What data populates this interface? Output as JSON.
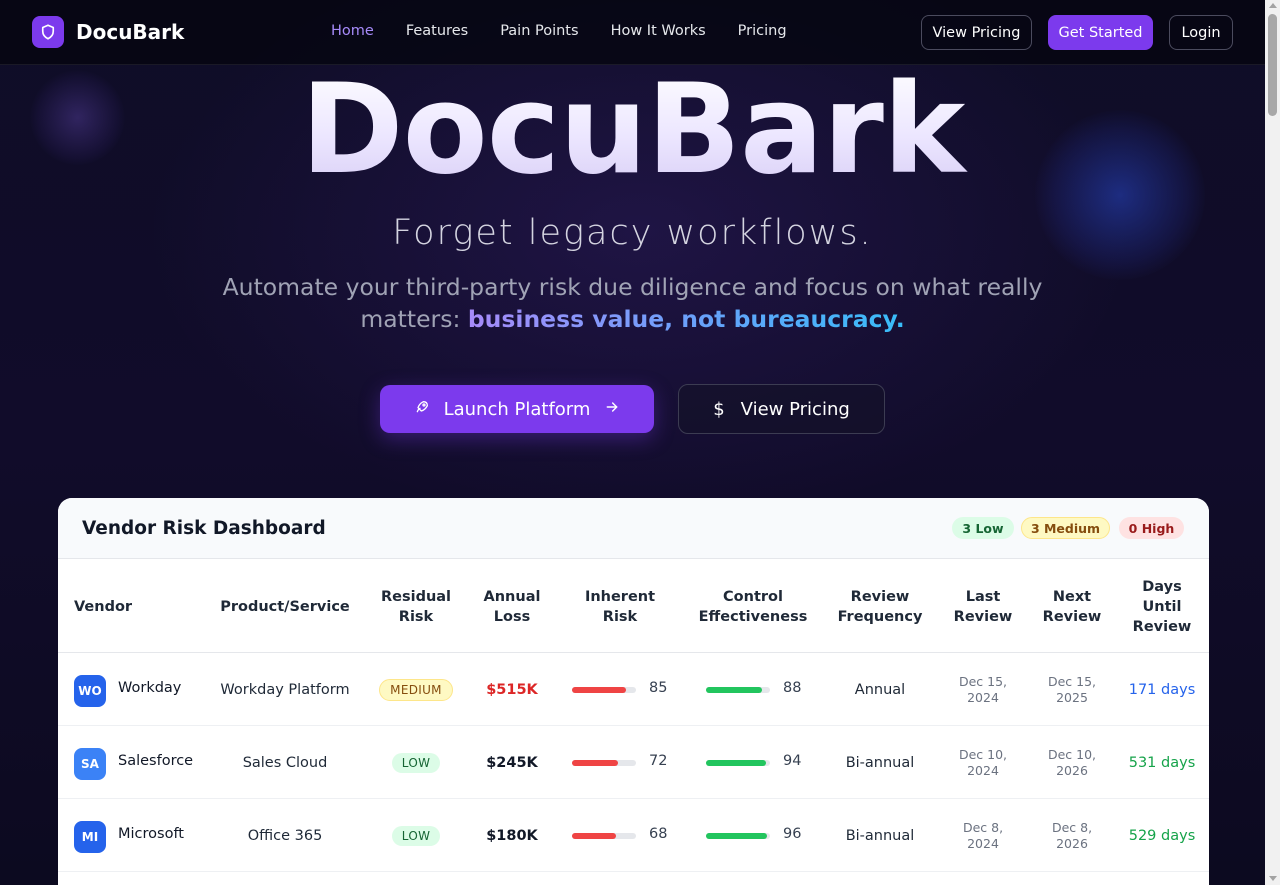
{
  "nav": {
    "brand": "DocuBark",
    "links": [
      "Home",
      "Features",
      "Pain Points",
      "How It Works",
      "Pricing"
    ],
    "view_pricing": "View Pricing",
    "get_started": "Get Started",
    "login": "Login"
  },
  "hero": {
    "title": "DocuBark",
    "subtitle": "Forget legacy workflows.",
    "desc_prefix": "Automate your third-party risk due diligence and focus on what really matters:",
    "desc_highlight": "business value, not bureaucracy.",
    "launch_label": "Launch Platform",
    "pricing_label": "View Pricing",
    "pricing_symbol": "$"
  },
  "dashboard": {
    "title": "Vendor Risk Dashboard",
    "counts": {
      "low": "3 Low",
      "medium": "3 Medium",
      "high": "0 High"
    },
    "columns": [
      "Vendor",
      "Product/Service",
      "Residual Risk",
      "Annual Loss",
      "Inherent Risk",
      "Control Effectiveness",
      "Review Frequency",
      "Last Review",
      "Next Review",
      "Days Until Review"
    ],
    "rows": [
      {
        "initials": "WO",
        "vendor": "Workday",
        "product": "Workday Platform",
        "risk": "MEDIUM",
        "loss": "$515K",
        "inherent": 85,
        "control": 88,
        "frequency": "Annual",
        "last_review": "Dec 15, 2024",
        "next_review": "Dec 15, 2025",
        "days": "171 days",
        "avatar_color": "#2563eb"
      },
      {
        "initials": "SA",
        "vendor": "Salesforce",
        "product": "Sales Cloud",
        "risk": "LOW",
        "loss": "$245K",
        "inherent": 72,
        "control": 94,
        "frequency": "Bi-annual",
        "last_review": "Dec 10, 2024",
        "next_review": "Dec 10, 2026",
        "days": "531 days",
        "avatar_color": "#3b82f6"
      },
      {
        "initials": "MI",
        "vendor": "Microsoft",
        "product": "Office 365",
        "risk": "LOW",
        "loss": "$180K",
        "inherent": 68,
        "control": 96,
        "frequency": "Bi-annual",
        "last_review": "Dec 8, 2024",
        "next_review": "Dec 8, 2026",
        "days": "529 days",
        "avatar_color": "#2563eb"
      }
    ]
  },
  "colors": {
    "accent": "#7c3aed",
    "inherent_bar": "#ef4444",
    "control_bar": "#22c55e",
    "loss_high": "#dc2626",
    "days_soon": "#2563eb",
    "days_far": "#16a34a"
  }
}
